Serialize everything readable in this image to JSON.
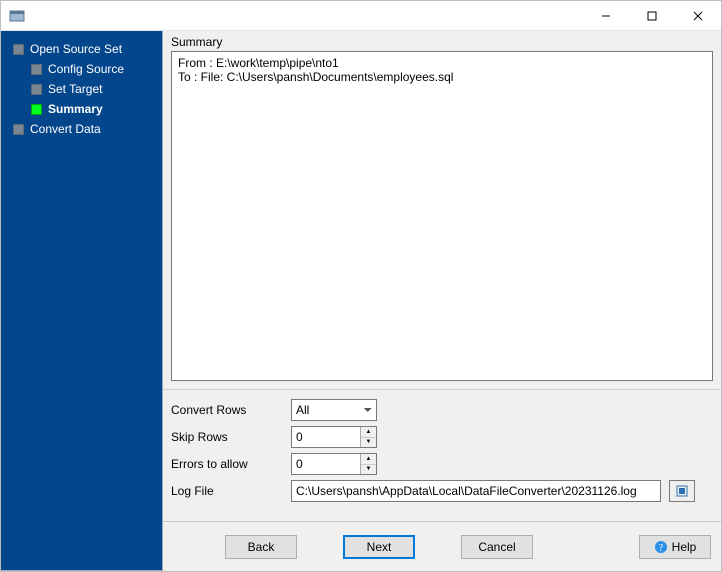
{
  "window": {
    "title": ""
  },
  "sidebar": {
    "items": [
      {
        "label": "Open Source Set",
        "indent": 0,
        "active": false
      },
      {
        "label": "Config Source",
        "indent": 1,
        "active": false
      },
      {
        "label": "Set Target",
        "indent": 1,
        "active": false
      },
      {
        "label": "Summary",
        "indent": 1,
        "active": true
      },
      {
        "label": "Convert Data",
        "indent": 0,
        "active": false
      }
    ]
  },
  "summary": {
    "heading": "Summary",
    "lines": [
      "From : E:\\work\\temp\\pipe\\nto1",
      "To : File: C:\\Users\\pansh\\Documents\\employees.sql"
    ]
  },
  "form": {
    "convert_rows_label": "Convert Rows",
    "convert_rows_value": "All",
    "skip_rows_label": "Skip Rows",
    "skip_rows_value": "0",
    "errors_label": "Errors to allow",
    "errors_value": "0",
    "logfile_label": "Log File",
    "logfile_value": "C:\\Users\\pansh\\AppData\\Local\\DataFileConverter\\20231126.log"
  },
  "buttons": {
    "back": "Back",
    "next": "Next",
    "cancel": "Cancel",
    "help": "Help"
  }
}
